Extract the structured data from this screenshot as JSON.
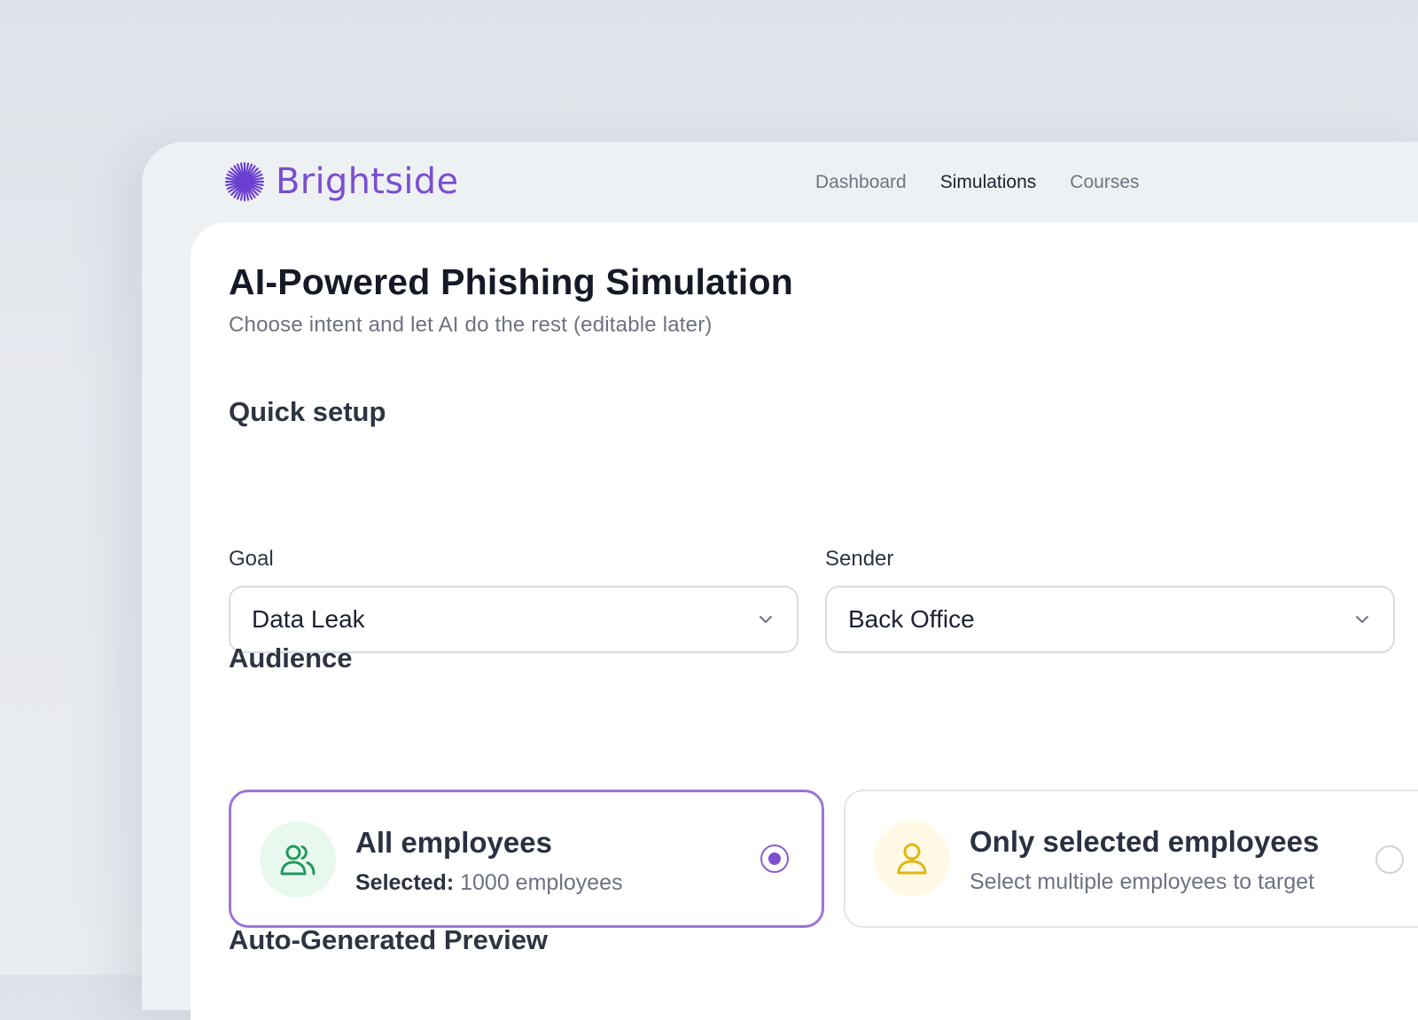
{
  "brand": {
    "name": "Brightside",
    "color": "#7a4fd0",
    "logo_icon": "starburst-icon"
  },
  "nav": {
    "items": [
      {
        "label": "Dashboard",
        "active": false
      },
      {
        "label": "Simulations",
        "active": true
      },
      {
        "label": "Courses",
        "active": false
      }
    ]
  },
  "page": {
    "title": "AI-Powered Phishing Simulation",
    "subtitle": "Choose intent and let AI do the rest (editable later)"
  },
  "quick_setup": {
    "heading": "Quick setup",
    "goal": {
      "label": "Goal",
      "value": "Data Leak",
      "icon": "chevron-down-icon"
    },
    "sender": {
      "label": "Sender",
      "value": "Back Office",
      "icon": "chevron-down-icon"
    }
  },
  "audience": {
    "heading": "Audience",
    "options": [
      {
        "title": "All employees",
        "desc_prefix": "Selected:",
        "desc": "1000 employees",
        "icon": "users-icon",
        "icon_color": "#1f9a5c",
        "icon_bg": "#e9f8ef",
        "selected": true
      },
      {
        "title": "Only selected employees",
        "desc": "Select multiple employees to target",
        "icon": "user-icon",
        "icon_color": "#e5b40e",
        "icon_bg": "#fff9e6",
        "selected": false
      }
    ],
    "accent": "#9d74d8"
  },
  "preview": {
    "heading": "Auto-Generated Preview"
  }
}
